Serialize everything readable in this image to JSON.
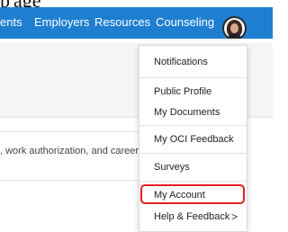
{
  "nav": {
    "items": [
      "ents",
      "Employers",
      "Resources",
      "Counseling"
    ],
    "colors": {
      "bar": "#1e7fd1",
      "text": "#ffffff"
    }
  },
  "page": {
    "body_text": ", work authorization, and career"
  },
  "menu": {
    "items": [
      {
        "label": "Notifications"
      },
      {
        "label": "Public Profile"
      },
      {
        "label": "My Documents"
      },
      {
        "label": "My OCI Feedback"
      },
      {
        "label": "Surveys"
      },
      {
        "label": "My Account",
        "highlighted": true
      },
      {
        "label": "Help & Feedback",
        "has_submenu": true
      }
    ],
    "submenu_icon": "chevron-right-icon",
    "highlight_color": "#e02020"
  }
}
